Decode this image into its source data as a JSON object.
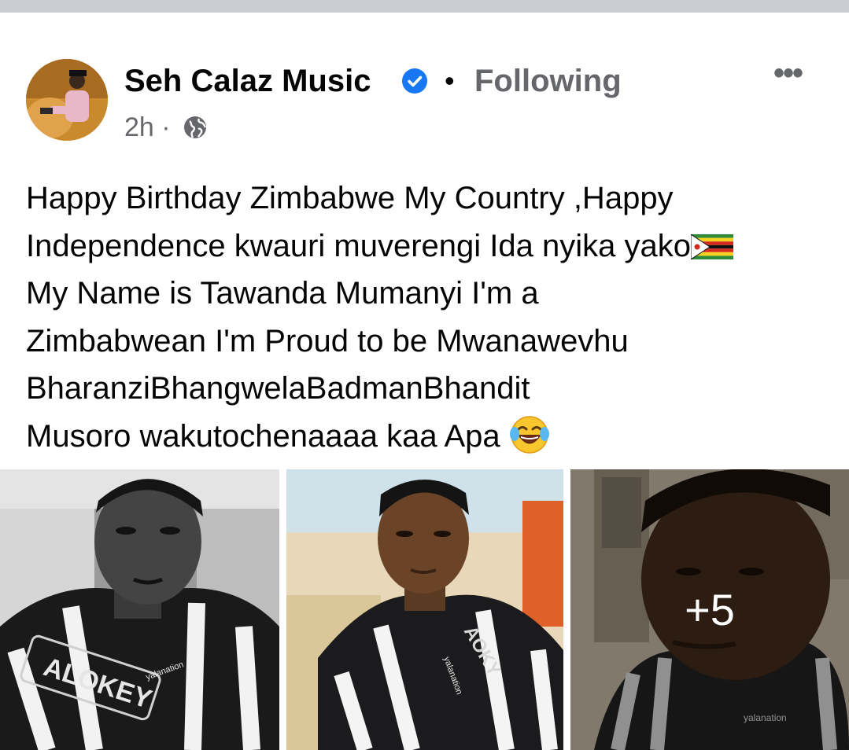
{
  "post": {
    "author": "Seh Calaz Music",
    "separator": "•",
    "follow_status": "Following",
    "time": "2h ·",
    "more_label": "•••",
    "text_lines": [
      "Happy Birthday Zimbabwe My Country ,Happy",
      "Independence kwauri muverengi Ida nyika yako",
      "My Name is Tawanda Mumanyi I'm a",
      "Zimbabwean  I'm Proud to be Mwanawevhu",
      "BharanziBhangwelaBadmanBhandit",
      "Musoro wakutochenaaaa kaa Apa"
    ],
    "emoji_flag": "zimbabwe-flag",
    "emoji_laugh": "tears-of-joy"
  },
  "photos": {
    "more_count": "+5",
    "items": [
      {
        "label": "grayscale portrait in barber cape",
        "cape_text": "ALOKEY",
        "watermark": "yalanation"
      },
      {
        "label": "color portrait in barber cape",
        "cape_text": "ALOKEY",
        "watermark": "yalanation"
      },
      {
        "label": "close-up in barber shop",
        "watermark": "yalanation"
      }
    ]
  },
  "colors": {
    "verified_blue": "#1877f2",
    "secondary_text": "#65676b",
    "divider": "#c9ccd1"
  },
  "icons": [
    "verified-badge-icon",
    "globe-icon",
    "more-options-icon"
  ]
}
